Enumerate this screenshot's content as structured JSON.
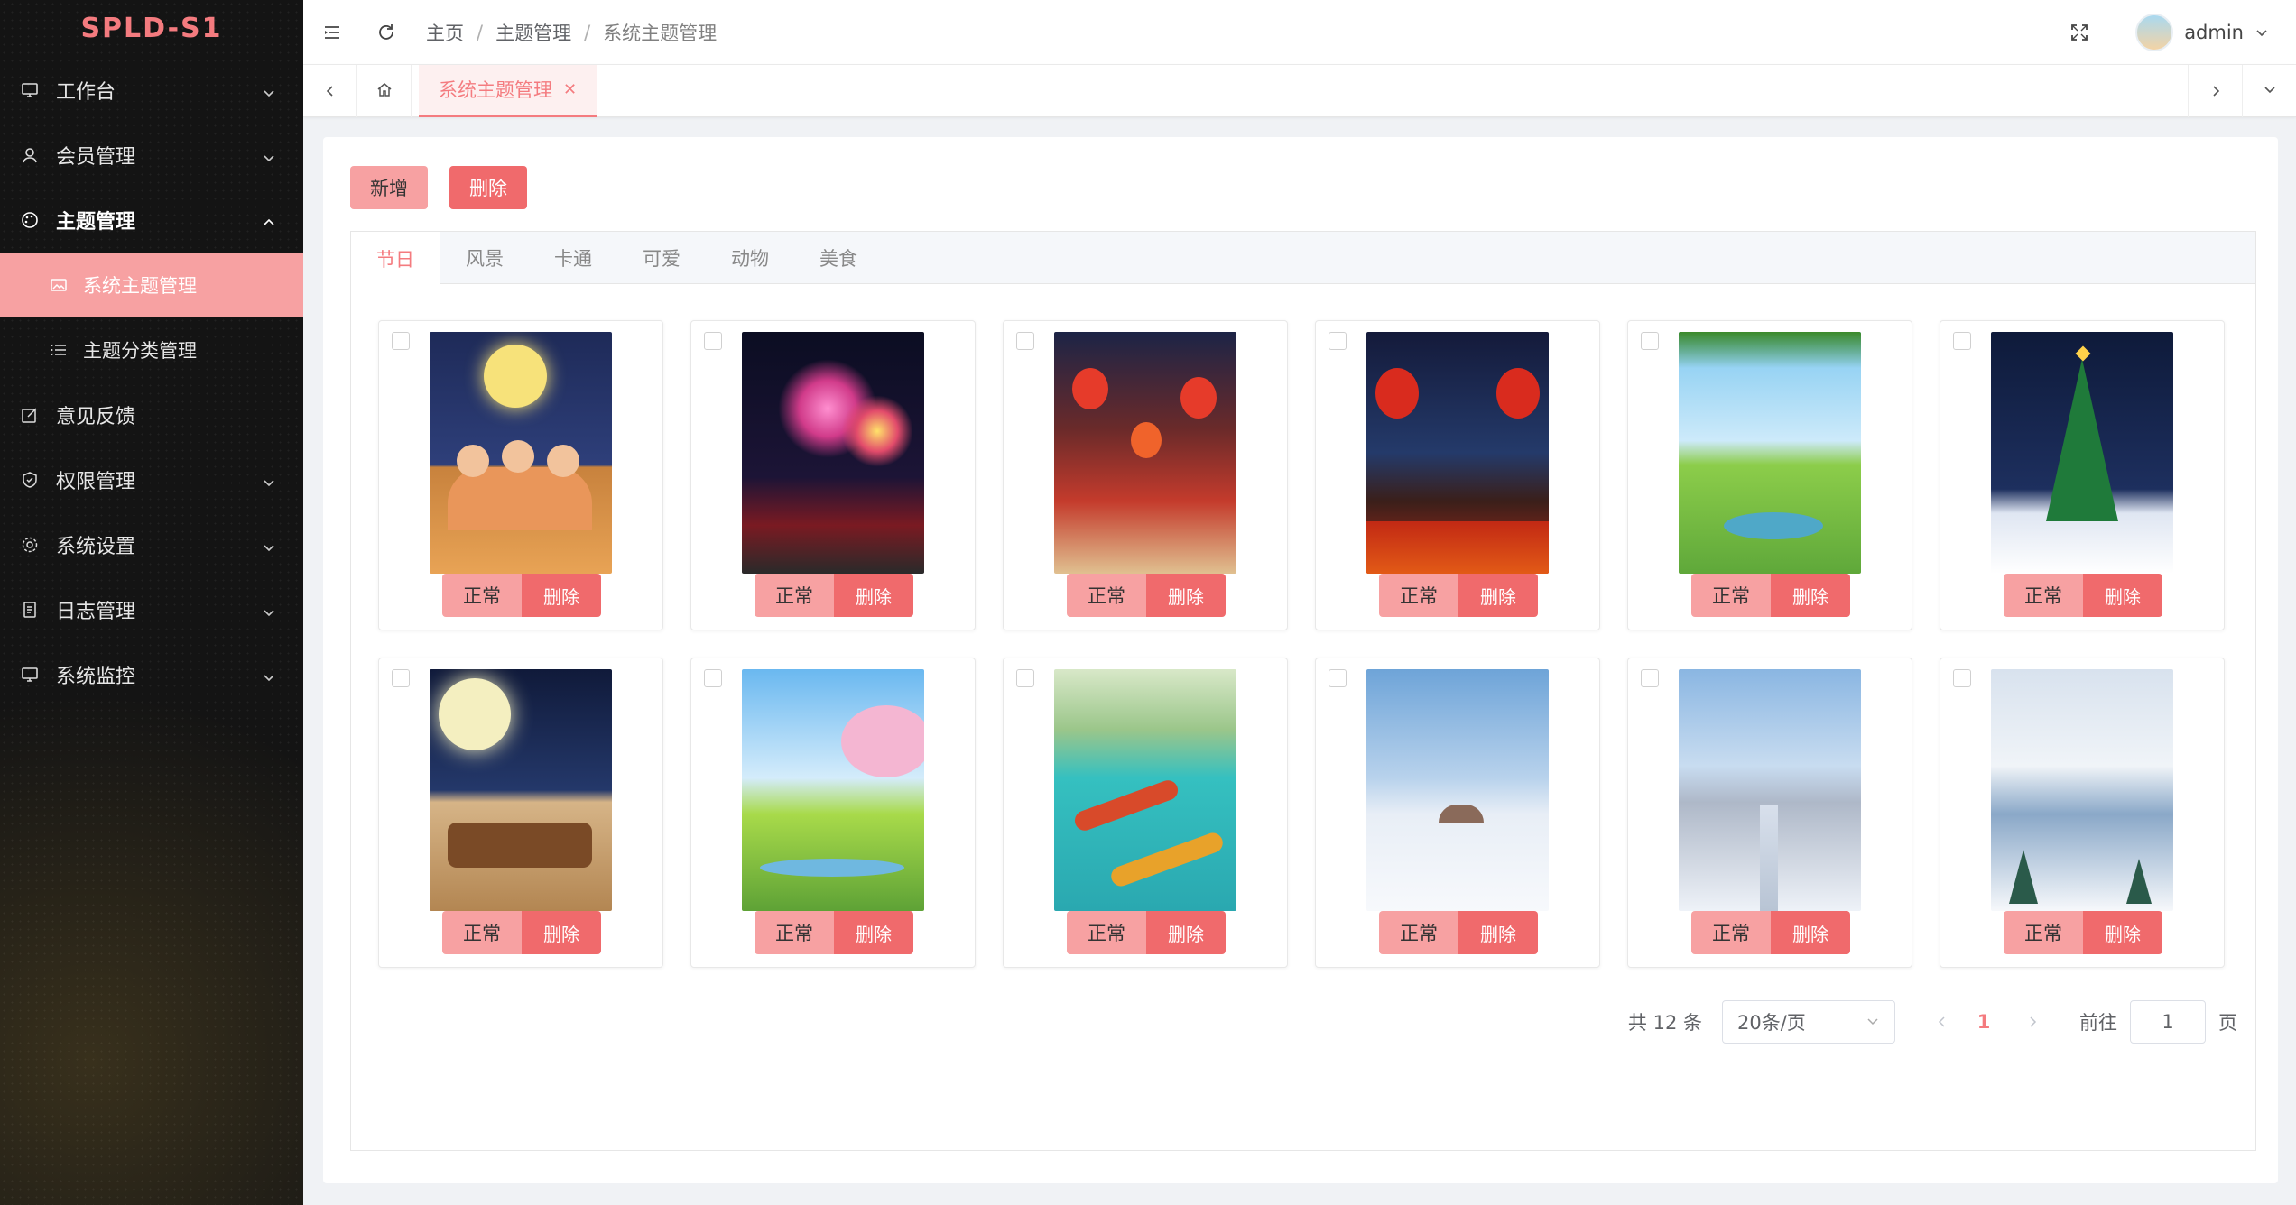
{
  "app": {
    "logo": "SPLD-S1"
  },
  "sidebar": {
    "items": [
      {
        "label": "工作台",
        "icon": "monitor-icon",
        "expandable": true
      },
      {
        "label": "会员管理",
        "icon": "user-icon",
        "expandable": true
      },
      {
        "label": "主题管理",
        "icon": "palette-icon",
        "expandable": true,
        "open": true,
        "children": [
          {
            "label": "系统主题管理",
            "icon": "image-icon",
            "active": true
          },
          {
            "label": "主题分类管理",
            "icon": "list-icon"
          }
        ]
      },
      {
        "label": "意见反馈",
        "icon": "edit-icon",
        "expandable": false
      },
      {
        "label": "权限管理",
        "icon": "shield-icon",
        "expandable": true
      },
      {
        "label": "系统设置",
        "icon": "gear-icon",
        "expandable": true
      },
      {
        "label": "日志管理",
        "icon": "document-icon",
        "expandable": true
      },
      {
        "label": "系统监控",
        "icon": "monitor-icon",
        "expandable": true
      }
    ]
  },
  "header": {
    "breadcrumb": [
      "主页",
      "主题管理",
      "系统主题管理"
    ],
    "username": "admin"
  },
  "tagsbar": {
    "active_tag": "系统主题管理"
  },
  "toolbar": {
    "add_label": "新增",
    "delete_label": "删除"
  },
  "tabs": [
    "节日",
    "风景",
    "卡通",
    "可爱",
    "动物",
    "美食"
  ],
  "active_tab": 0,
  "cards": [
    {
      "theme": "mid-autumn-family",
      "status_label": "正常",
      "delete_label": "删除"
    },
    {
      "theme": "fireworks-city",
      "status_label": "正常",
      "delete_label": "删除"
    },
    {
      "theme": "lantern-street",
      "status_label": "正常",
      "delete_label": "删除"
    },
    {
      "theme": "lantern-window",
      "status_label": "正常",
      "delete_label": "删除"
    },
    {
      "theme": "spring-meadow",
      "status_label": "正常",
      "delete_label": "删除"
    },
    {
      "theme": "christmas-tree",
      "status_label": "正常",
      "delete_label": "删除"
    },
    {
      "theme": "moon-dinner",
      "status_label": "正常",
      "delete_label": "删除"
    },
    {
      "theme": "cherry-field",
      "status_label": "正常",
      "delete_label": "删除"
    },
    {
      "theme": "dragon-boat",
      "status_label": "正常",
      "delete_label": "删除"
    },
    {
      "theme": "snow-bridge",
      "status_label": "正常",
      "delete_label": "删除"
    },
    {
      "theme": "snow-path",
      "status_label": "正常",
      "delete_label": "删除"
    },
    {
      "theme": "snow-mountain",
      "status_label": "正常",
      "delete_label": "删除"
    }
  ],
  "pagination": {
    "total_label": "共 12 条",
    "page_size_label": "20条/页",
    "current_page": "1",
    "goto_label": "前往",
    "goto_value": "1",
    "page_suffix": "页"
  },
  "colors": {
    "accent": "#f47b7f",
    "accent_light": "#f7a1a2",
    "danger": "#f06a6c"
  }
}
